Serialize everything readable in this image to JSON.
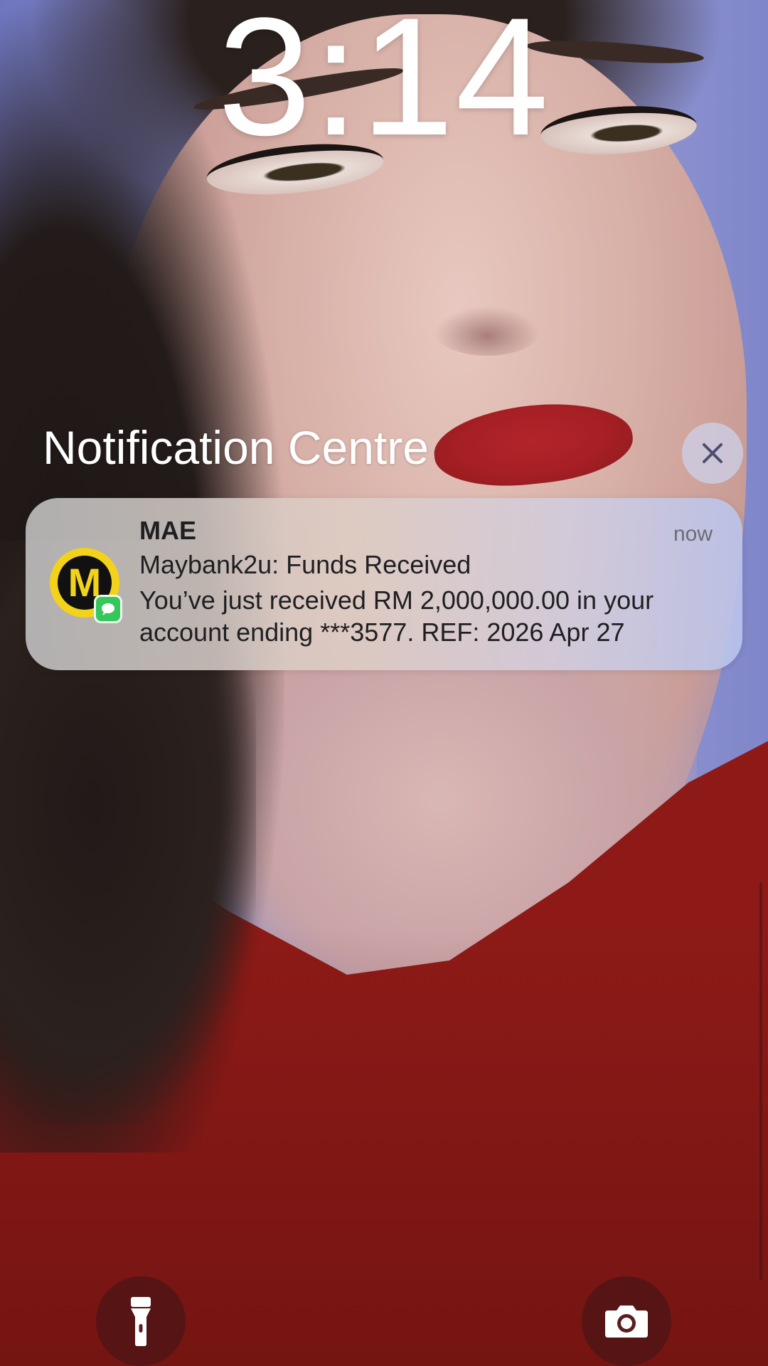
{
  "lock_screen": {
    "time": "3:14"
  },
  "notification_centre": {
    "title": "Notification Centre",
    "clear_icon": "close-icon"
  },
  "notification": {
    "app_name": "MAE",
    "timestamp": "now",
    "title": "Maybank2u: Funds Received",
    "body": "You’ve just received RM 2,000,000.00 in your account ending ***3577. REF: 2026 Apr 27",
    "app_icon_letter": "M",
    "app_icon": "maybank-mae-icon",
    "badge_icon": "messages-icon",
    "colors": {
      "icon_yellow": "#f3d21c",
      "icon_black": "#111111",
      "badge_green": "#34c759"
    }
  },
  "quick_actions": {
    "left_icon": "flashlight-icon",
    "right_icon": "camera-icon"
  }
}
